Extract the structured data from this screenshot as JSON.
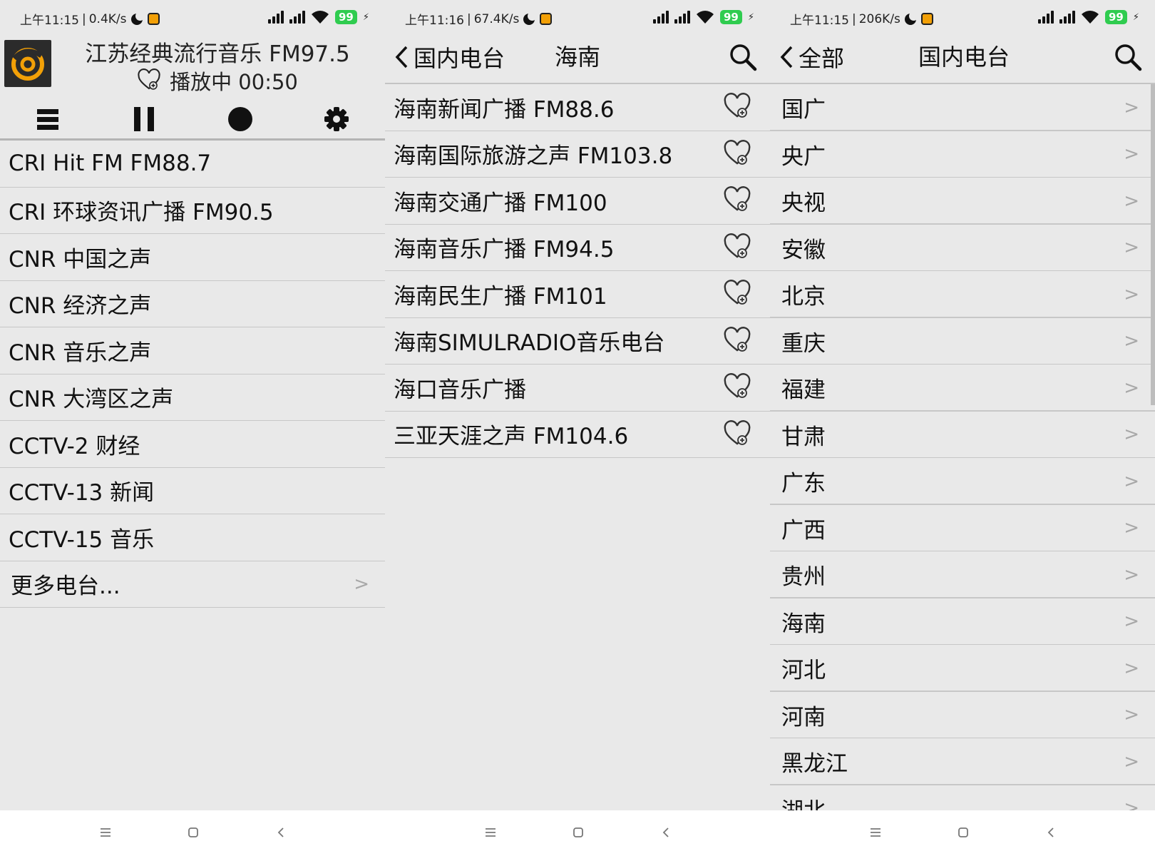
{
  "colors": {
    "panel_bg": "#e9e9e9",
    "battery": "#2fcc4f",
    "logo_accent": "#f2a007",
    "divider": "#c7c7c7"
  },
  "panel1": {
    "status": {
      "time": "上午11:15",
      "speed": "0.4K/s",
      "battery": "99"
    },
    "title": "江苏经典流行音乐 FM97.5",
    "playing_text": "播放中 00:50",
    "toolbar": [
      "menu-icon",
      "pause-icon",
      "record-icon",
      "gear-icon"
    ],
    "items": [
      "CRI Hit FM FM88.7",
      "CRI 环球资讯广播 FM90.5",
      "CNR 中国之声",
      "CNR 经济之声",
      "CNR 音乐之声",
      "CNR 大湾区之声",
      "CCTV-2 财经",
      "CCTV-13 新闻",
      "CCTV-15 音乐"
    ],
    "more": {
      "label": "更多电台...",
      "chevron": ">"
    }
  },
  "panel2": {
    "status": {
      "time": "上午11:16",
      "speed": "67.4K/s",
      "battery": "99"
    },
    "back_label": "国内电台",
    "title": "海南",
    "items": [
      "海南新闻广播 FM88.6",
      "海南国际旅游之声 FM103.8",
      "海南交通广播 FM100",
      "海南音乐广播 FM94.5",
      "海南民生广播 FM101",
      "海南SIMULRADIO音乐电台",
      "海口音乐广播",
      "三亚天涯之声 FM104.6"
    ]
  },
  "panel3": {
    "status": {
      "time": "上午11:15",
      "speed": "206K/s",
      "battery": "99"
    },
    "back_label": "全部",
    "title": "国内电台",
    "chevron": ">",
    "items": [
      "国广",
      "央广",
      "央视",
      "安徽",
      "北京",
      "重庆",
      "福建",
      "甘肃",
      "广东",
      "广西",
      "贵州",
      "海南",
      "河北",
      "河南",
      "黑龙江",
      "湖北"
    ]
  }
}
